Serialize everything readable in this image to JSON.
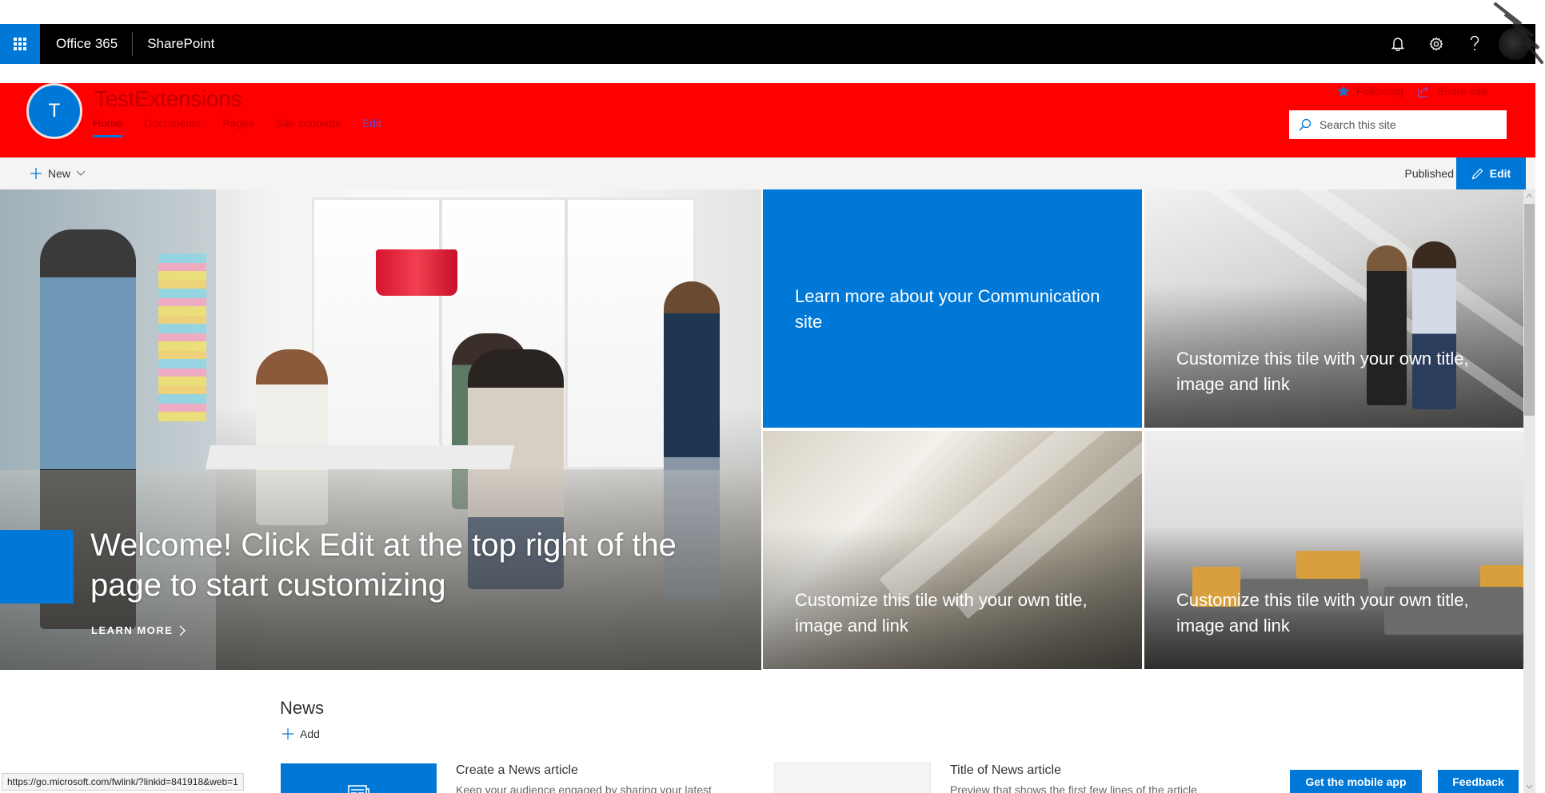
{
  "suitebar": {
    "brand": "Office 365",
    "app": "SharePoint",
    "icons": [
      "waffle-icon",
      "bell-icon",
      "gear-icon",
      "help-icon",
      "user-avatar"
    ]
  },
  "site": {
    "logo_letter": "T",
    "title": "TestExtensions",
    "nav": [
      {
        "label": "Home",
        "active": true
      },
      {
        "label": "Documents"
      },
      {
        "label": "Pages"
      },
      {
        "label": "Site contents"
      },
      {
        "label": "Edit"
      }
    ],
    "following_label": "Following",
    "share_label": "Share site",
    "search_placeholder": "Search this site",
    "header_color": "#ff0000"
  },
  "commandbar": {
    "new_label": "New",
    "status": "Published",
    "edit_label": "Edit"
  },
  "hero": {
    "main_title": "Welcome! Click Edit at the top right of the page to start customizing",
    "learn_more": "LEARN MORE",
    "tiles": [
      {
        "text": "Learn more about your Communication site"
      },
      {
        "text": "Customize this tile with your own title, image and link"
      },
      {
        "text": "Customize this tile with your own title, image and link"
      },
      {
        "text": "Customize this tile with your own title, image and link"
      }
    ]
  },
  "news": {
    "title": "News",
    "add_label": "Add",
    "items": [
      {
        "title": "Create a News article",
        "desc": "Keep your audience engaged by sharing your latest"
      },
      {
        "title": "Title of News article",
        "desc": "Preview that shows the first few lines of the article"
      }
    ]
  },
  "footer": {
    "mobile_app": "Get the mobile app",
    "feedback": "Feedback"
  },
  "status_bar": {
    "url": "https://go.microsoft.com/fwlink/?linkid=841918&web=1"
  },
  "colors": {
    "accent": "#0078d7",
    "suitebar": "#000000",
    "header": "#ff0000",
    "commandbar": "#f4f4f4"
  }
}
